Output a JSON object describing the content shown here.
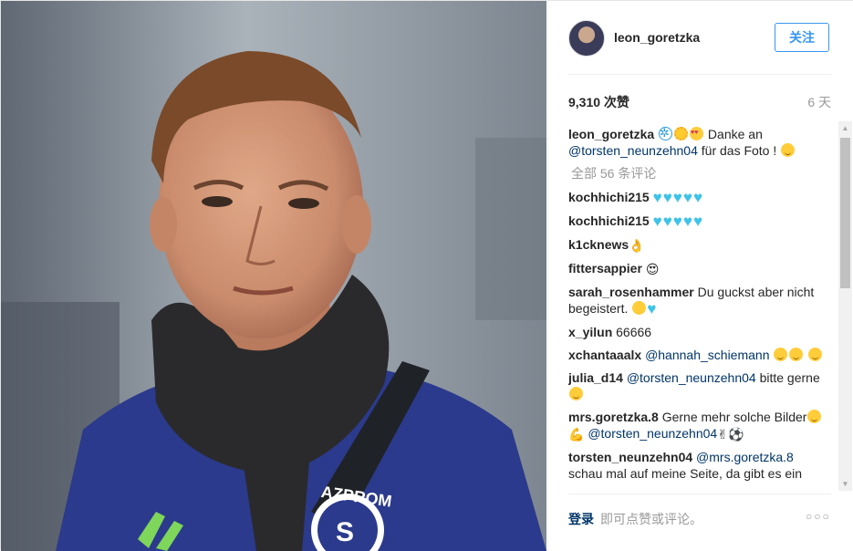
{
  "post": {
    "username": "leon_goretzka",
    "follow_label": "关注",
    "likes": "9,310 次赞",
    "time_ago": "6 天",
    "caption": {
      "username": "leon_goretzka",
      "text_before": "Danke an",
      "mention": "@torsten_neunzehn04",
      "text_after": "für das Foto !"
    },
    "view_all_comments": "全部 56 条评论",
    "comments": [
      {
        "user": "kochhichi215",
        "text": "",
        "hearts": 5
      },
      {
        "user": "kochhichi215",
        "text": "",
        "hearts": 5
      },
      {
        "user": "k1cknews",
        "text": "👌"
      },
      {
        "user": "fittersappier",
        "text": "😍"
      },
      {
        "user": "sarah_rosenhammer",
        "text": "Du guckst aber nicht begeistert."
      },
      {
        "user": "x_yilun",
        "text": "66666"
      },
      {
        "user": "xchantaaalx",
        "mention": "@hannah_schiemann",
        "text": ""
      },
      {
        "user": "julia_d14",
        "mention": "@torsten_neunzehn04",
        "text": "bitte gerne"
      },
      {
        "user": "mrs.goretzka.8",
        "text": "Gerne mehr solche Bilder",
        "mention": "@torsten_neunzehn04"
      },
      {
        "user": "torsten_neunzehn04",
        "mention": "@mrs.goretzka.8",
        "text": "schau mal auf meine Seite, da gibt es ein"
      }
    ]
  },
  "footer": {
    "login": "登录",
    "prompt": "即可点赞或评论。",
    "more": "○○○"
  },
  "icons": {
    "scroll_up": "▲",
    "scroll_down": "▼",
    "heart": "♥"
  },
  "colors": {
    "accent": "#3897f0",
    "mention": "#003569",
    "heart": "#3ec3e8"
  }
}
